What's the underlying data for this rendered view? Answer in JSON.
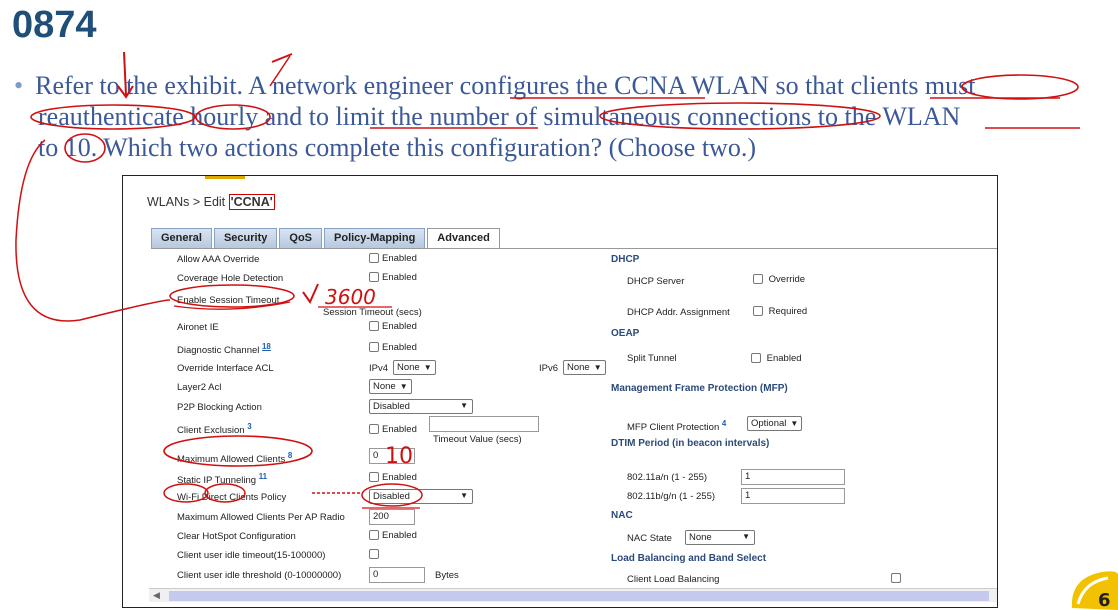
{
  "slide": {
    "number": "0874"
  },
  "question": {
    "bullet": "•",
    "line1": "Refer to the exhibit. A network engineer configures the CCNA WLAN so that clients must",
    "line2": "reauthenticate hourly and to limit the number of simultaneous connections to the WLAN",
    "line3": "to 10. Which two actions complete this configuration? (Choose two.)"
  },
  "exhibit": {
    "breadcrumb": "WLANs > Edit",
    "wlan_name": "'CCNA'",
    "tabs": [
      "General",
      "Security",
      "QoS",
      "Policy-Mapping",
      "Advanced"
    ],
    "active_tab": "Advanced",
    "left": {
      "aaa_override": {
        "label": "Allow AAA Override",
        "cb": "Enabled"
      },
      "coverage_hole": {
        "label": "Coverage Hole Detection",
        "cb": "Enabled"
      },
      "session_timeout": {
        "label": "Enable Session Timeout",
        "sub": "Session Timeout (secs)"
      },
      "aironet_ie": {
        "label": "Aironet IE",
        "cb": "Enabled"
      },
      "diag_channel": {
        "label": "Diagnostic Channel",
        "sup": "18",
        "cb": "Enabled"
      },
      "override_acl": {
        "label": "Override Interface ACL",
        "ipv4_label": "IPv4",
        "ipv4_value": "None",
        "ipv6_label": "IPv6",
        "ipv6_value": "None"
      },
      "layer2_acl": {
        "label": "Layer2 Acl",
        "value": "None"
      },
      "p2p": {
        "label": "P2P Blocking Action",
        "value": "Disabled"
      },
      "client_exclusion": {
        "label": "Client Exclusion",
        "sup": "3",
        "cb": "Enabled",
        "sub": "Timeout Value (secs)"
      },
      "max_clients": {
        "label": "Maximum Allowed Clients",
        "sup": "8",
        "value": "0"
      },
      "static_ip": {
        "label": "Static IP Tunneling",
        "sup": "11",
        "cb": "Enabled"
      },
      "wifi_direct": {
        "label": "Wi-Fi Direct Clients Policy",
        "value": "Disabled"
      },
      "max_per_radio": {
        "label": "Maximum Allowed Clients Per AP Radio",
        "value": "200"
      },
      "hotspot": {
        "label": "Clear HotSpot Configuration",
        "cb": "Enabled"
      },
      "idle_timeout": {
        "label": "Client user idle timeout(15-100000)"
      },
      "idle_threshold": {
        "label": "Client user idle threshold (0-10000000)",
        "value": "0",
        "unit": "Bytes"
      }
    },
    "right": {
      "dhcp_title": "DHCP",
      "dhcp_server": {
        "label": "DHCP Server",
        "cb": "Override"
      },
      "dhcp_addr": {
        "label": "DHCP Addr. Assignment",
        "cb": "Required"
      },
      "oeap_title": "OEAP",
      "split_tunnel": {
        "label": "Split Tunnel",
        "cb": "Enabled"
      },
      "mfp_title": "Management Frame Protection (MFP)",
      "mfp_client": {
        "label": "MFP Client Protection",
        "sup": "4",
        "value": "Optional"
      },
      "dtim_title": "DTIM Period (in beacon intervals)",
      "dtim_a": {
        "label": "802.11a/n (1 - 255)",
        "value": "1"
      },
      "dtim_b": {
        "label": "802.11b/g/n (1 - 255)",
        "value": "1"
      },
      "nac_title": "NAC",
      "nac_state": {
        "label": "NAC State",
        "value": "None"
      },
      "lb_title": "Load Balancing and Band Select",
      "client_lb": {
        "label": "Client Load Balancing"
      }
    }
  },
  "annotations": {
    "timeout_handwritten": "3600",
    "clients_handwritten": "10"
  },
  "logo": {
    "number": "6"
  },
  "colors": {
    "title": "#1f4e79",
    "question": "#3b5998",
    "section": "#2b4a7a",
    "ink": "#d01010"
  }
}
